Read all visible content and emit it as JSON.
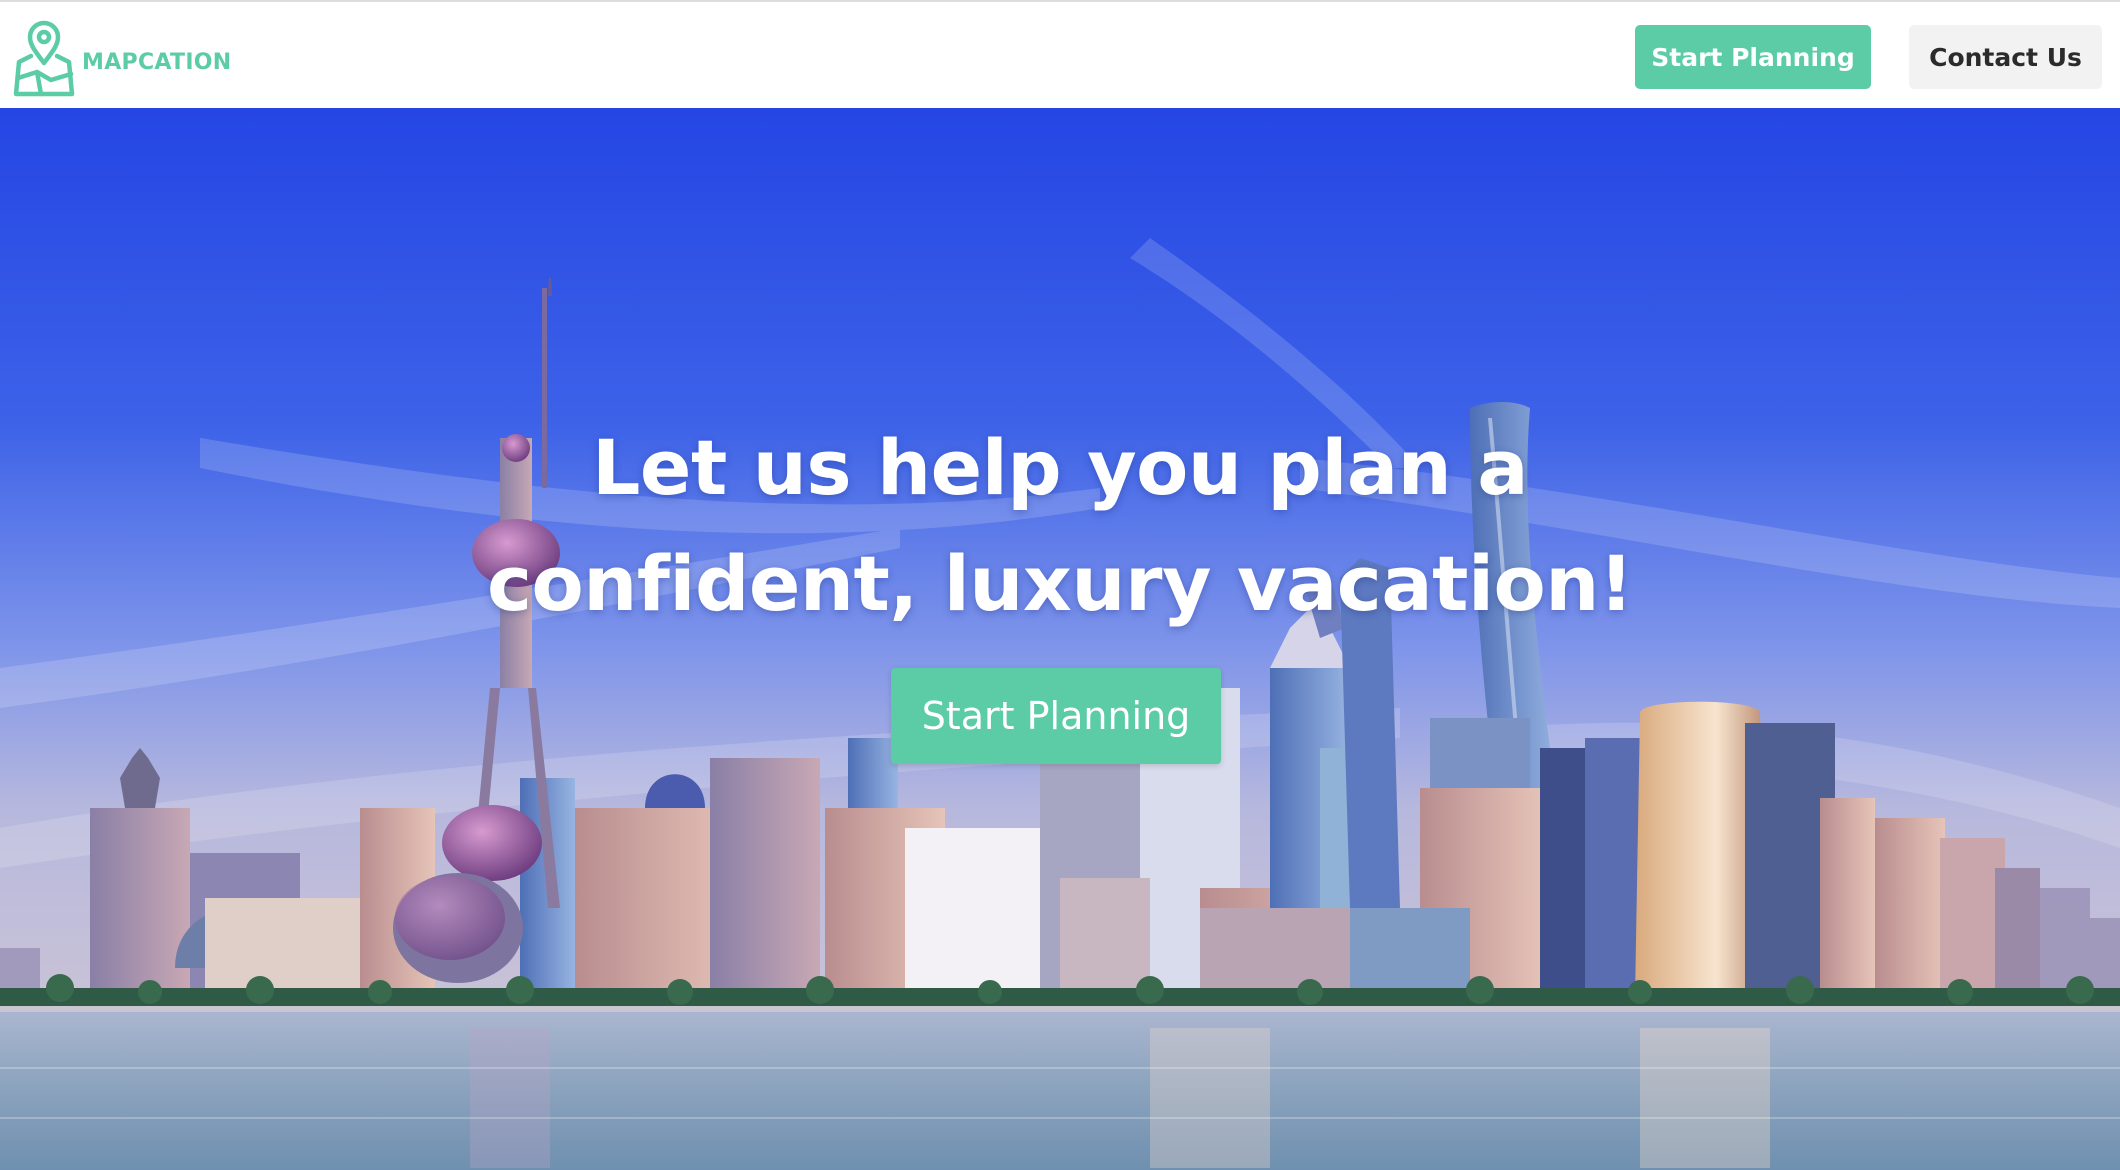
{
  "brand": {
    "name": "MAPCATION",
    "icon": "map-pin-icon",
    "color": "#5bcca5"
  },
  "nav": {
    "start_planning_label": "Start Planning",
    "contact_label": "Contact Us"
  },
  "hero": {
    "heading_line1": "Let us help you plan a",
    "heading_line2": "confident, luxury vacation!",
    "cta_label": "Start Planning",
    "background": "city-skyline-image"
  },
  "colors": {
    "accent": "#5bcca5",
    "secondary_button": "#f2f2f2",
    "sky": "#2c4fe6"
  }
}
